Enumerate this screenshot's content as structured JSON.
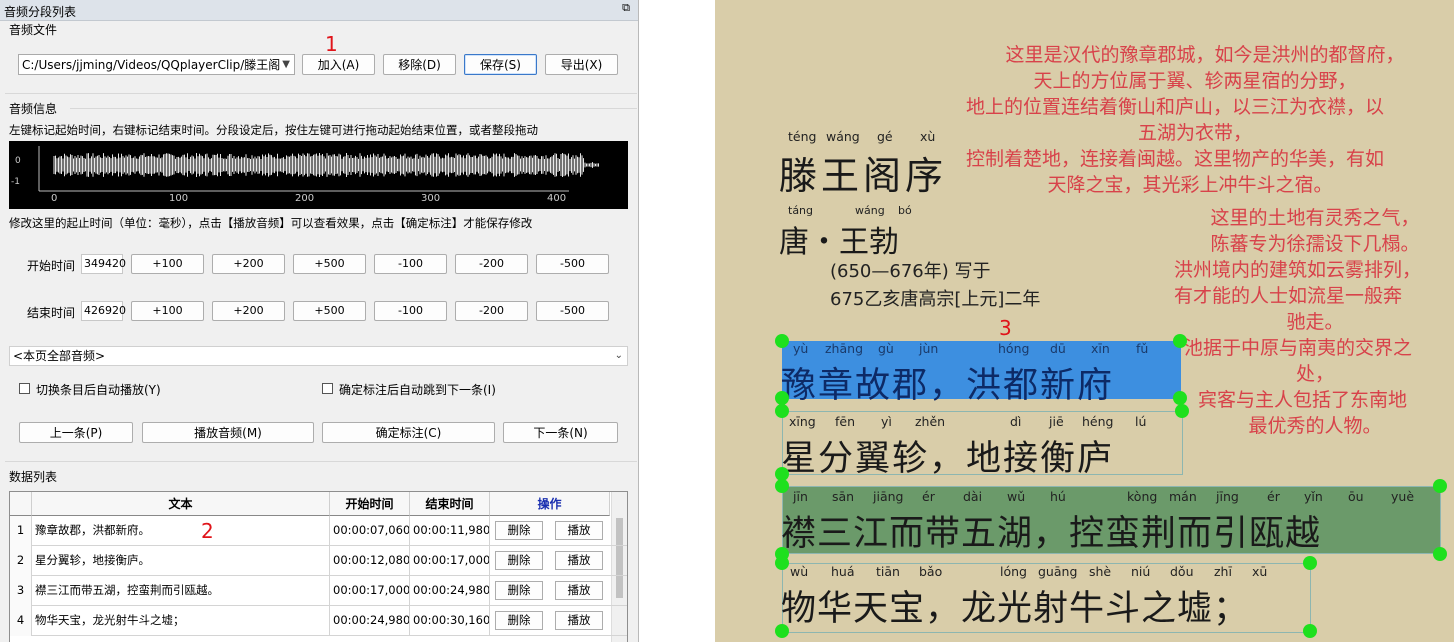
{
  "panel": {
    "title": "音频分段列表",
    "pin_icon": "⧉"
  },
  "audio_file": {
    "group_title": "音频文件",
    "path": "C:/Users/jjming/Videos/QQplayerClip/滕王阁",
    "buttons": {
      "add": "加入(A)",
      "remove": "移除(D)",
      "save": "保存(S)",
      "export": "导出(X)"
    }
  },
  "audio_info": {
    "group_title": "音频信息",
    "hint": "左键标记起始时间，右键标记结束时间。分段设定后，按住左键可进行拖动起始结束位置，或者整段拖动",
    "axis_y": [
      "0",
      "-1"
    ],
    "axis_x": [
      "0",
      "100",
      "200",
      "300",
      "400"
    ],
    "edit_hint": "修改这里的起止时间（单位：毫秒），点击【播放音频】可以查看效果，点击【确定标注】才能保存修改",
    "start_label": "开始时间",
    "start_value": "349420",
    "end_label": "结束时间",
    "end_value": "426920",
    "adjust": [
      "+100",
      "+200",
      "+500",
      "-100",
      "-200",
      "-500"
    ],
    "scope": "<本页全部音频>",
    "auto_play": "切换条目后自动播放(Y)",
    "auto_next": "确定标注后自动跳到下一条(I)",
    "prev": "上一条(P)",
    "play": "播放音频(M)",
    "confirm": "确定标注(C)",
    "next": "下一条(N)"
  },
  "data_list": {
    "group_title": "数据列表",
    "headers": {
      "text": "文本",
      "start": "开始时间",
      "end": "结束时间",
      "op": "操作"
    },
    "delete_label": "删除",
    "play_label": "播放",
    "rows": [
      {
        "n": "1",
        "text": "豫章故郡，洪都新府。",
        "start": "00:00:07,060",
        "end": "00:00:11,980"
      },
      {
        "n": "2",
        "text": "星分翼轸，地接衡庐。",
        "start": "00:00:12,080",
        "end": "00:00:17,000"
      },
      {
        "n": "3",
        "text": "襟三江而带五湖，控蛮荆而引瓯越。",
        "start": "00:00:17,000",
        "end": "00:00:24,980"
      },
      {
        "n": "4",
        "text": "物华天宝，龙光射牛斗之墟；",
        "start": "00:00:24,980",
        "end": "00:00:30,160"
      }
    ]
  },
  "markers": {
    "m1": "1",
    "m2": "2",
    "m3": "3"
  },
  "art": {
    "title_pinyin": [
      "téng",
      "wáng",
      "gé",
      "xù"
    ],
    "title": "滕王阁序",
    "author_pinyin": [
      "táng",
      "wáng",
      "bó"
    ],
    "author": "唐・王勃",
    "date1": "(650—676年) 写于",
    "date2": "675乙亥唐高宗[上元]二年",
    "lines": [
      {
        "pinyin": [
          "yù",
          "zhāng",
          "gù",
          "jùn",
          "hóng",
          "dū",
          "xīn",
          "fǔ"
        ],
        "text": "豫章故郡，洪都新府"
      },
      {
        "pinyin": [
          "xīng",
          "fēn",
          "yì",
          "zhěn",
          "dì",
          "jiē",
          "héng",
          "lú"
        ],
        "text": "星分翼轸，地接衡庐"
      },
      {
        "pinyin": [
          "jīn",
          "sān",
          "jiāng",
          "ér",
          "dài",
          "wǔ",
          "hú",
          "kòng",
          "mán",
          "jīng",
          "ér",
          "yǐn",
          "ōu",
          "yuè"
        ],
        "text": "襟三江而带五湖，控蛮荆而引瓯越"
      },
      {
        "pinyin": [
          "wù",
          "huá",
          "tiān",
          "bǎo",
          "lóng",
          "guāng",
          "shè",
          "niú",
          "dǒu",
          "zhī",
          "xū"
        ],
        "text": "物华天宝，龙光射牛斗之墟；"
      }
    ],
    "translation_a": [
      "这里是汉代的豫章郡城，如今是洪州的都督府，",
      "天上的方位属于翼、轸两星宿的分野，",
      "地上的位置连结着衡山和庐山，以三江为衣襟，以",
      "五湖为衣带，",
      "控制着楚地，连接着闽越。这里物产的华美，有如",
      "天降之宝，其光彩上冲牛斗之宿。"
    ],
    "translation_b": [
      "这里的土地有灵秀之气，",
      "陈蕃专为徐孺设下几榻。",
      "洪州境内的建筑如云雾排列，",
      "有才能的人士如流星一般奔",
      "驰走。",
      "池据于中原与南夷的交界之",
      "处，",
      "宾客与主人包括了东南地",
      "最优秀的人物。"
    ],
    "colors": {
      "blue": "#3d8fe0",
      "green": "#6b9a6a",
      "dot": "#1ee01e",
      "red_text": "#d8424a"
    }
  }
}
